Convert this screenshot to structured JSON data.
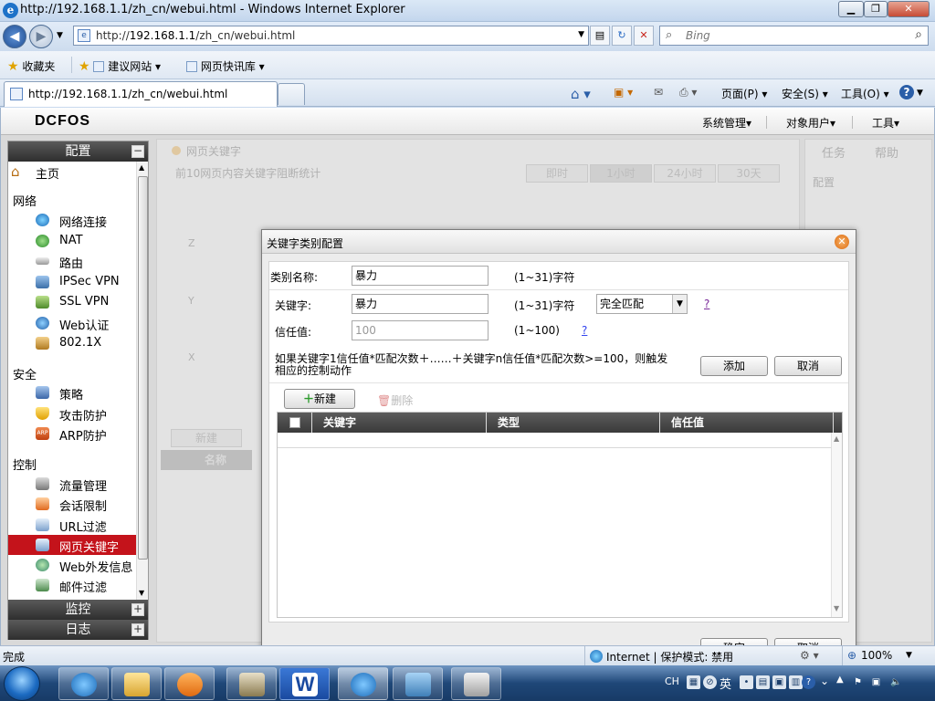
{
  "window": {
    "title": "http://192.168.1.1/zh_cn/webui.html - Windows Internet Explorer",
    "minimize": "▁",
    "restore": "❐",
    "close": "✕"
  },
  "address": {
    "url_prefix": "http://",
    "url_host": "192.168.1.1",
    "url_path": "/zh_cn/webui.html",
    "search_placeholder": "Bing"
  },
  "favorites_bar": {
    "favorites": "收藏夹",
    "suggested_sites": "建议网站 ▾",
    "web_slice_gallery": "网页快讯库 ▾"
  },
  "tab": {
    "title": "http://192.168.1.1/zh_cn/webui.html"
  },
  "command_bar": {
    "page": "页面(P) ▾",
    "safety": "安全(S) ▾",
    "tools": "工具(O) ▾",
    "help": "?"
  },
  "app": {
    "logo": "DCFOS",
    "menu": [
      "系统管理▾",
      "对象用户▾",
      "工具▾"
    ]
  },
  "sidebar": {
    "config_header": "配置",
    "collapse": "−",
    "home": "主页",
    "groups": [
      {
        "label": "网络",
        "items": [
          "网络连接",
          "NAT",
          "路由",
          "IPSec VPN",
          "SSL VPN",
          "Web认证",
          "802.1X"
        ]
      },
      {
        "label": "安全",
        "items": [
          "策略",
          "攻击防护",
          "ARP防护"
        ]
      },
      {
        "label": "控制",
        "items": [
          "流量管理",
          "会话限制",
          "URL过滤",
          "网页关键字",
          "Web外发信息",
          "邮件过滤"
        ]
      }
    ],
    "selected": "网页关键字",
    "monitor_header": "监控",
    "log_header": "日志",
    "expand": "+"
  },
  "background": {
    "panel_title": "网页关键字",
    "subtitle": "前10网页内容关键字阻断统计",
    "time_buttons": [
      "即时",
      "1小时",
      "24小时",
      "30天"
    ],
    "axis_labels": [
      "Z",
      "Y",
      "X"
    ],
    "new_button": "新建",
    "name_column": "名称",
    "task_tabs": [
      "任务",
      "帮助"
    ],
    "task_config": "配置"
  },
  "dialog": {
    "title": "关键字类别配置",
    "category_label": "类别名称:",
    "category_value": "暴力",
    "category_hint": "(1~31)字符",
    "keyword_label": "关键字:",
    "keyword_value": "暴力",
    "keyword_hint": "(1~31)字符",
    "match_type": "完全匹配",
    "trust_label": "信任值:",
    "trust_value": "100",
    "trust_hint": "(1~100)",
    "help_mark": "?",
    "rule_text_line1": "如果关键字1信任值*匹配次数＋……＋关键字n信任值*匹配次数>=100，则触发",
    "rule_text_line2": "相应的控制动作",
    "add_button": "添加",
    "cancel_button": "取消",
    "new_button": "新建",
    "delete_button": "删除",
    "columns": [
      "关键字",
      "类型",
      "信任值"
    ],
    "ok_button": "确定",
    "footer_cancel": "取消"
  },
  "status": {
    "text": "完成",
    "zone": "Internet | 保护模式: 禁用",
    "zoom": "100%"
  },
  "taskbar": {
    "lang": "CH",
    "ime": "英",
    "time_hidden": ""
  }
}
